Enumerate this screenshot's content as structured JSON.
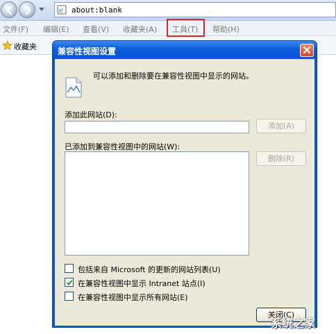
{
  "browser": {
    "address": "about:blank",
    "menu": [
      {
        "label": "文件(F)"
      },
      {
        "label": "编辑(E)"
      },
      {
        "label": "查看(V)"
      },
      {
        "label": "收藏夹(A)"
      },
      {
        "label": "工具(T)"
      },
      {
        "label": "帮助(H)"
      }
    ],
    "highlighted_menu": "工具(T)",
    "highlight_color": "#e0212b",
    "favorites_label": "收藏夹"
  },
  "dialog": {
    "title": "兼容性视图设置",
    "info_text": "可以添加和删除要在兼容性视图中显示的网站。",
    "add_site_label": "添加此网站(D):",
    "add_site_value": "",
    "add_button": "添加(A)",
    "list_label": "已添加到兼容性视图中的网站(W):",
    "sites": [],
    "remove_button": "删除(R)",
    "checkboxes": [
      {
        "label": "包括来自 Microsoft 的更新的网站列表(U)",
        "checked": false
      },
      {
        "label": "在兼容性视图中显示 Intranet 站点(I)",
        "checked": true
      },
      {
        "label": "在兼容性视图中显示所有网站(E)",
        "checked": false
      }
    ],
    "close_button": "关闭(C)"
  },
  "watermark": "系统之家"
}
